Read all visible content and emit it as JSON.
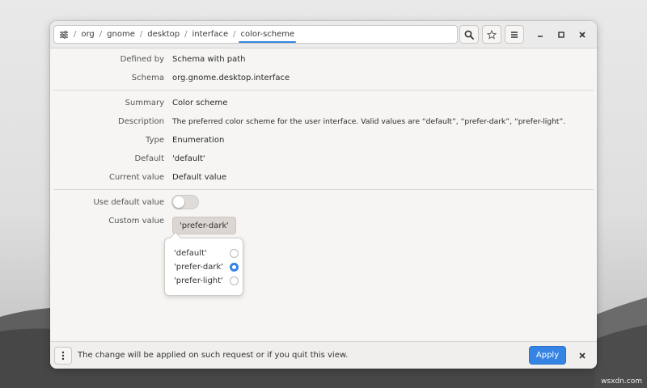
{
  "pathbar": {
    "home_icon": "settings-tree-icon",
    "separator": "/",
    "items": [
      "org",
      "gnome",
      "desktop",
      "interface",
      "color-scheme"
    ]
  },
  "headerbar": {
    "search_icon": "search-icon",
    "bookmark_icon": "star-icon",
    "menu_icon": "hamburger-menu-icon",
    "minimize_icon": "minimize-icon",
    "maximize_icon": "maximize-icon",
    "close_icon": "close-icon"
  },
  "details": {
    "defined_by": {
      "label": "Defined by",
      "value": "Schema with path"
    },
    "schema": {
      "label": "Schema",
      "value": "org.gnome.desktop.interface"
    },
    "summary": {
      "label": "Summary",
      "value": "Color scheme"
    },
    "description": {
      "label": "Description",
      "value": "The preferred color scheme for the user interface. Valid values are “default”, “prefer-dark”, “prefer-light”."
    },
    "type": {
      "label": "Type",
      "value": "Enumeration"
    },
    "default": {
      "label": "Default",
      "value": "'default'"
    },
    "current_value": {
      "label": "Current value",
      "value": "Default value"
    }
  },
  "settings": {
    "use_default_label": "Use default value",
    "use_default_on": false,
    "custom_value_label": "Custom value",
    "custom_value": "'prefer-dark'"
  },
  "popover": {
    "options": [
      {
        "label": "'default'",
        "checked": false
      },
      {
        "label": "'prefer-dark'",
        "checked": true
      },
      {
        "label": "'prefer-light'",
        "checked": false
      }
    ]
  },
  "bottombar": {
    "menu_icon": "vertical-dots-icon",
    "message": "The change will be applied on such request or if you quit this view.",
    "apply_label": "Apply",
    "close_icon": "close-icon"
  },
  "watermark": "wsxdn.com",
  "colors": {
    "accent": "#3584e4",
    "window_bg": "#f6f5f4",
    "headerbar_bg": "#ebebeb"
  }
}
